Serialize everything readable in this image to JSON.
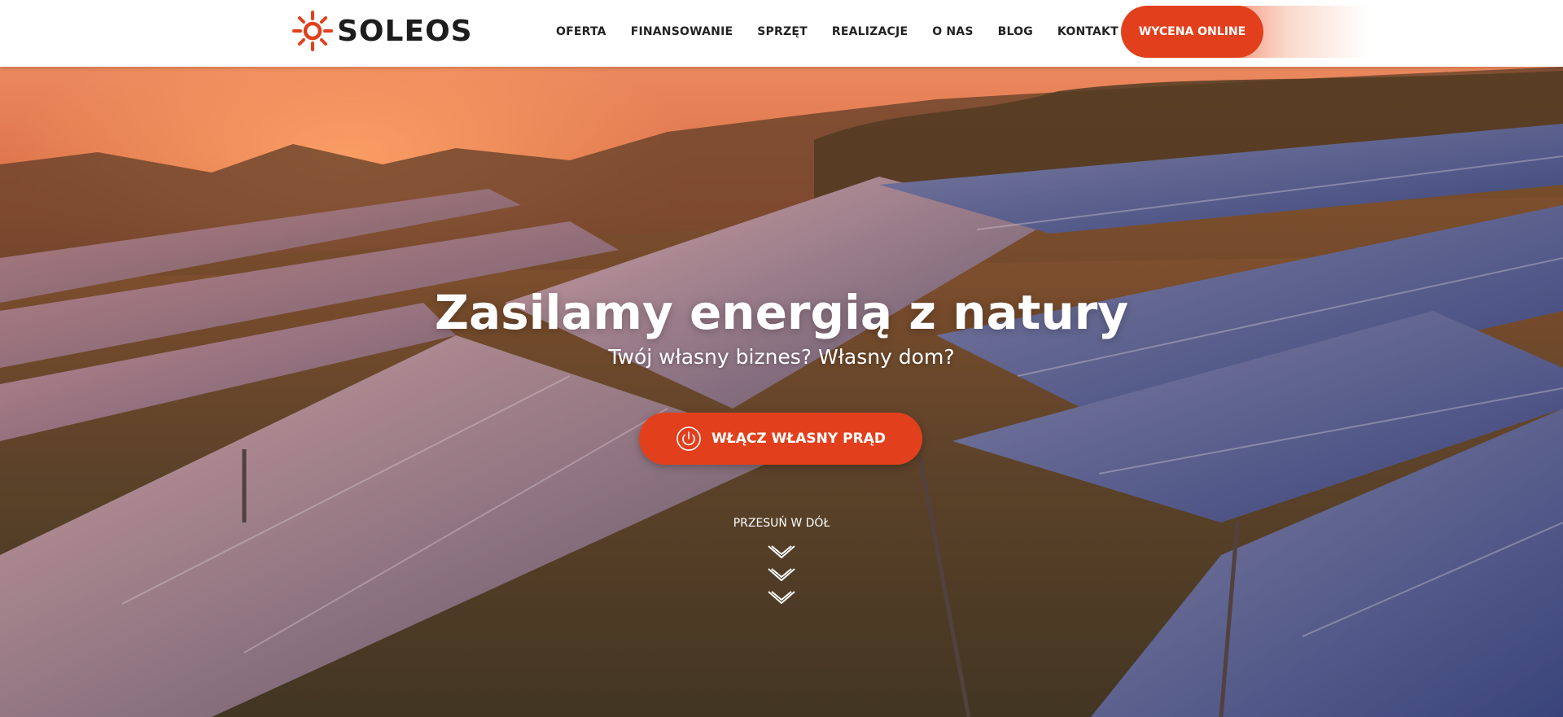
{
  "brand": {
    "name": "SOLEOS",
    "accent": "#e2401c"
  },
  "nav": {
    "items": [
      {
        "label": "OFERTA"
      },
      {
        "label": "FINANSOWANIE"
      },
      {
        "label": "SPRZĘT"
      },
      {
        "label": "REALIZACJE"
      },
      {
        "label": "O NAS"
      },
      {
        "label": "BLOG"
      },
      {
        "label": "KONTAKT"
      }
    ],
    "cta_label": "WYCENA ONLINE"
  },
  "hero": {
    "title": "Zasilamy energią z natury",
    "subtitle": "Twój własny biznes? Własny dom?",
    "button_label": "WŁĄCZ WŁASNY PRĄD",
    "button_icon": "power-icon",
    "scroll_label": "PRZESUŃ W DÓŁ",
    "scroll_icon": "chevrons-down-icon",
    "background": "solar-panels-sunset"
  }
}
